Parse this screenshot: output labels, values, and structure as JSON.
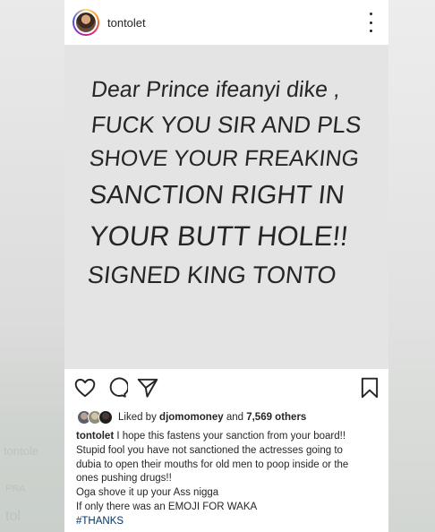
{
  "post": {
    "username": "tontolet",
    "image_lines": [
      "Dear Prince ifeanyi dike ,",
      "FUCK YOU SIR AND PLS",
      "SHOVE YOUR FREAKING",
      "SANCTION RIGHT IN",
      "YOUR BUTT HOLE!!",
      "SIGNED KING TONTO"
    ],
    "likes": {
      "prefix": "Liked by",
      "user": "djomomoney",
      "middle": "and",
      "count": "7,569 others"
    },
    "caption": {
      "author": "tontolet",
      "lines": [
        "I hope this fastens your sanction from your board!!",
        "Stupid fool you have not sanctioned the actresses going to",
        "dubia to open their mouths for old men to poop inside or the",
        "ones pushing drugs!!",
        "Oga shove it up your Ass nigga",
        "If only there was an EMOJI FOR WAKA"
      ],
      "hashtag": "#THANKS"
    }
  },
  "background_text": [
    "tontole",
    "PRA",
    "tol"
  ],
  "colors": {
    "text": "#262626",
    "hashtag": "#003569",
    "image_bg": "#e4e4e4"
  },
  "icons": [
    "more-options-icon",
    "heart-icon",
    "comment-icon",
    "share-icon",
    "bookmark-icon"
  ]
}
